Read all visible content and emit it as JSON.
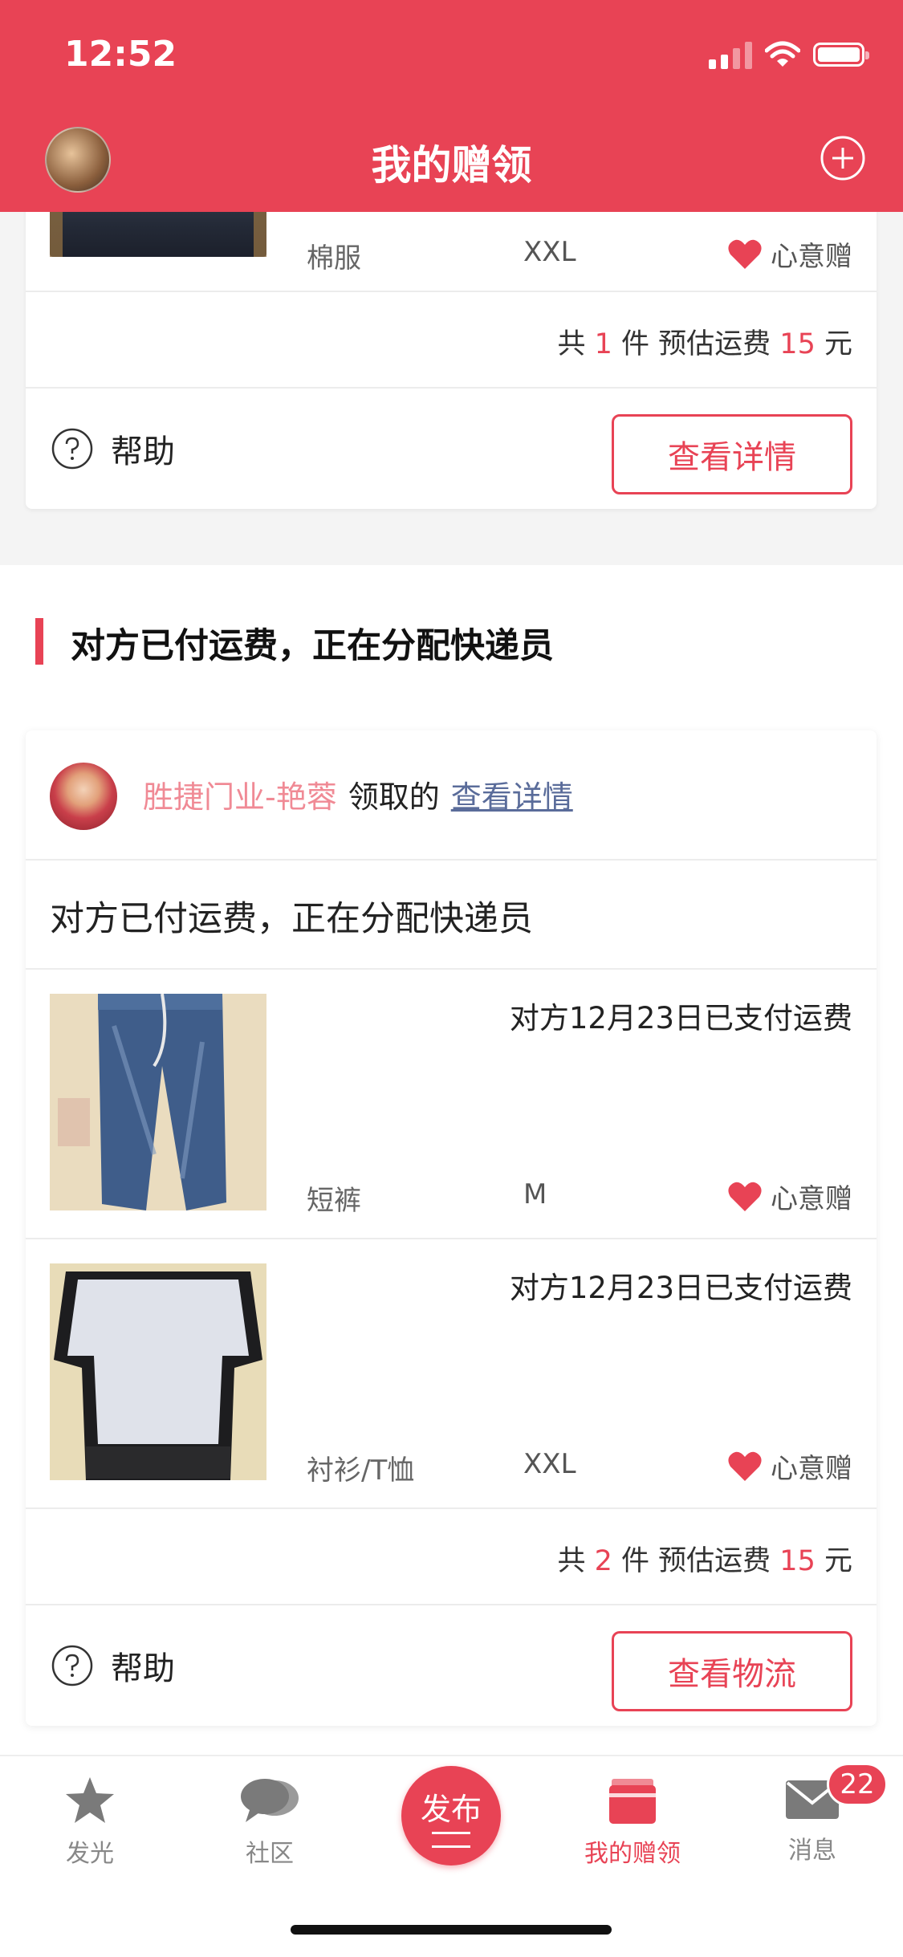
{
  "status_bar": {
    "time": "12:52"
  },
  "header": {
    "title": "我的赠领"
  },
  "top_card": {
    "item": {
      "category": "棉服",
      "size": "XXL",
      "tag": "心意赠"
    },
    "summary": {
      "prefix": "共",
      "count": "1",
      "mid": "件 预估运费",
      "fee": "15",
      "unit": "元"
    },
    "help_label": "帮助",
    "action_label": "查看详情"
  },
  "section": {
    "title": "对方已付运费，正在分配快递员"
  },
  "order_card": {
    "user_name": "胜捷门业-艳蓉",
    "received_text": "领取的",
    "detail_link": "查看详情",
    "status_text": "对方已付运费，正在分配快递员",
    "items": [
      {
        "paid_text": "对方12月23日已支付运费",
        "category": "短裤",
        "size": "M",
        "tag": "心意赠"
      },
      {
        "paid_text": "对方12月23日已支付运费",
        "category": "衬衫/T恤",
        "size": "XXL",
        "tag": "心意赠"
      }
    ],
    "summary": {
      "prefix": "共",
      "count": "2",
      "mid": "件 预估运费",
      "fee": "15",
      "unit": "元"
    },
    "help_label": "帮助",
    "action_label": "查看物流"
  },
  "tabbar": {
    "tabs": [
      {
        "label": "发光",
        "icon": "star-icon"
      },
      {
        "label": "社区",
        "icon": "chat-bubble-icon"
      },
      {
        "label": "发布",
        "icon": "publish-icon"
      },
      {
        "label": "我的赠领",
        "icon": "gift-box-icon"
      },
      {
        "label": "消息",
        "icon": "mail-icon"
      }
    ],
    "message_badge": "22"
  },
  "colors": {
    "accent": "#e84355",
    "link": "#5a6c9a",
    "username": "#f08a95"
  }
}
